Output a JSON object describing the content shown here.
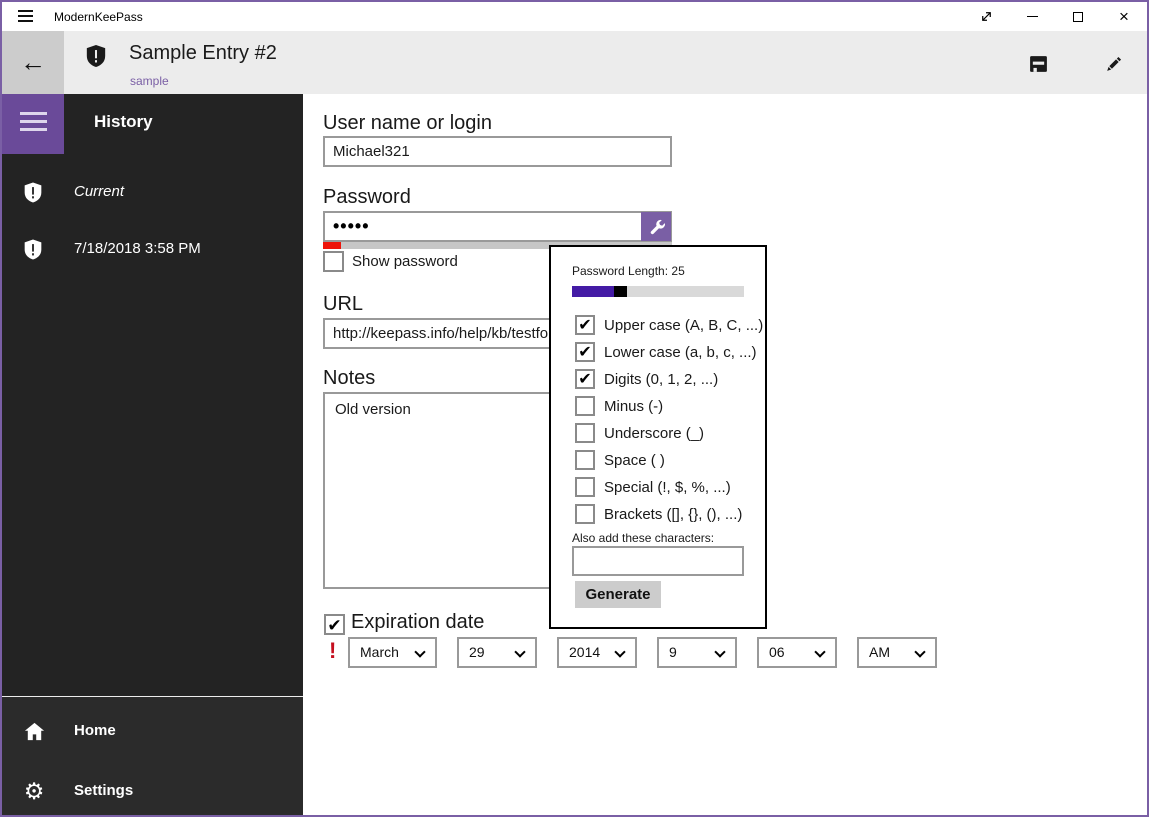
{
  "window": {
    "title": "ModernKeePass",
    "controls": {
      "fullscreen_icon": "diagonal-resize-arrow",
      "minimize_icon": "minimize-bar",
      "maximize_icon": "maximize-box",
      "close_glyph": "×"
    }
  },
  "icons": {
    "back_arrow": "←",
    "gear": "⚙",
    "exclamation": "!"
  },
  "header": {
    "title": "Sample Entry #2",
    "subtitle": "sample"
  },
  "sidebar": {
    "section_title": "History",
    "items": [
      {
        "label": "Current",
        "icon": "shield-icon",
        "italic": true
      },
      {
        "label": "7/18/2018 3:58 PM",
        "icon": "shield-icon",
        "italic": false
      }
    ],
    "footer": [
      {
        "label": "Home",
        "icon": "home-icon"
      },
      {
        "label": "Settings",
        "icon": "gear-icon"
      }
    ]
  },
  "form": {
    "username_label": "User name or login",
    "username_value": "Michael321",
    "password_label": "Password",
    "password_value": "•••••",
    "show_password_label": "Show password",
    "show_password_checked": false,
    "show_password_mark": "",
    "url_label": "URL",
    "url_value": "http://keepass.info/help/kb/testfo",
    "notes_label": "Notes",
    "notes_value": "Old version",
    "expiration_label": "Expiration date",
    "expiration_checked": true,
    "expiration_mark": "✔",
    "date": {
      "month": "March",
      "day": "29",
      "year": "2014",
      "hour": "9",
      "minute": "06",
      "period": "AM"
    }
  },
  "generator": {
    "length_label": "Password Length: 25",
    "length_value": 25,
    "options": [
      {
        "label": "Upper case (A, B, C, ...)",
        "checked": true,
        "mark": "✔"
      },
      {
        "label": "Lower case (a, b, c, ...)",
        "checked": true,
        "mark": "✔"
      },
      {
        "label": "Digits (0, 1, 2, ...)",
        "checked": true,
        "mark": "✔"
      },
      {
        "label": "Minus (-)",
        "checked": false,
        "mark": ""
      },
      {
        "label": "Underscore (_)",
        "checked": false,
        "mark": ""
      },
      {
        "label": "Space ( )",
        "checked": false,
        "mark": ""
      },
      {
        "label": "Special (!, $, %, ...)",
        "checked": false,
        "mark": ""
      },
      {
        "label": "Brackets ([], {}, (), ...)",
        "checked": false,
        "mark": ""
      }
    ],
    "also_label": "Also add these characters:",
    "also_value": "",
    "generate_label": "Generate"
  },
  "colors": {
    "accent_purple": "#7a5fa5",
    "hamburger_purple": "#6a4a99",
    "slider_fill": "#441ba5",
    "strength_red": "#ee140a",
    "error_red": "#c50f1f",
    "sidebar_bg": "#232323",
    "sidebar_footer_bg": "#2b2b2b",
    "header_bg": "#ececec",
    "back_button_bg": "#cccccc",
    "input_border": "#999999",
    "generate_button_bg": "#cccccc",
    "popup_border": "#000000"
  }
}
